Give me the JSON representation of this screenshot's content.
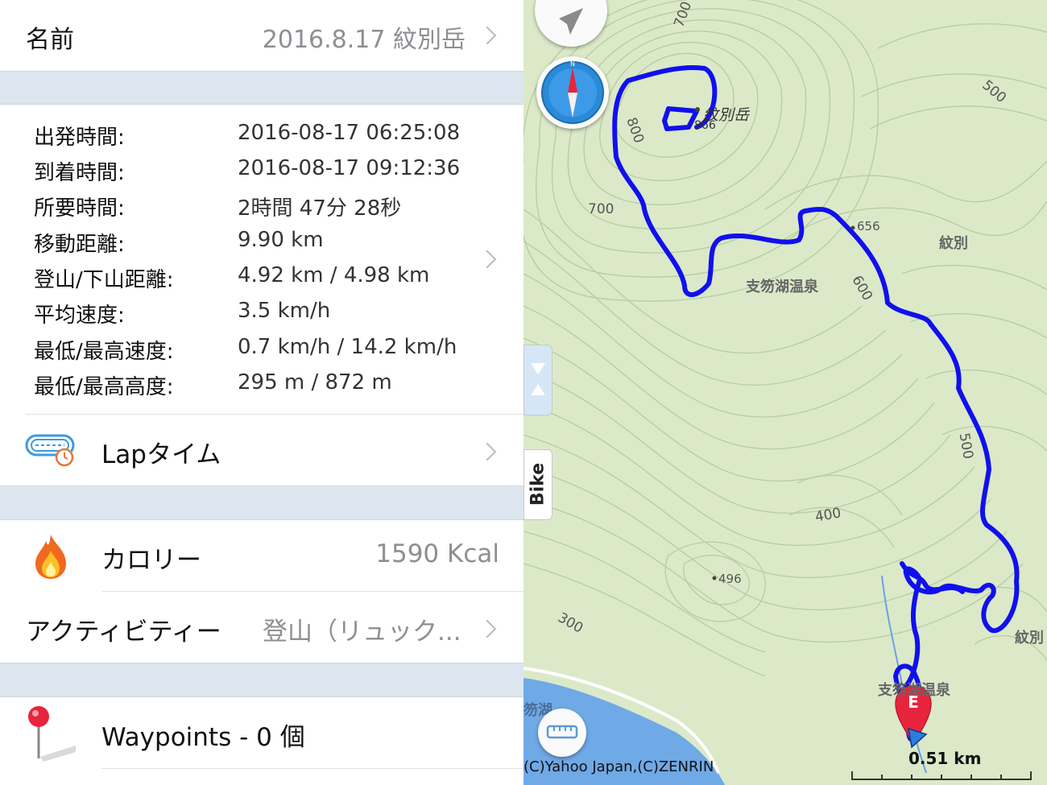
{
  "record": {
    "name_label": "名前",
    "name_value": "2016.8.17 紋別岳"
  },
  "stats": [
    {
      "label": "出発時間:",
      "value": "2016-08-17 06:25:08"
    },
    {
      "label": "到着時間:",
      "value": "2016-08-17 09:12:36"
    },
    {
      "label": "所要時間:",
      "value": "2時間 47分 28秒"
    },
    {
      "label": "移動距離:",
      "value": "9.90 km"
    },
    {
      "label": "登山/下山距離:",
      "value": "4.92 km / 4.98 km"
    },
    {
      "label": "平均速度:",
      "value": "3.5 km/h"
    },
    {
      "label": "最低/最高速度:",
      "value": "0.7 km/h / 14.2 km/h"
    },
    {
      "label": "最低/最高高度:",
      "value": "295 m / 872 m"
    }
  ],
  "lap": {
    "label": "Lapタイム"
  },
  "calories": {
    "label": "カロリー",
    "value": "1590 Kcal"
  },
  "activity": {
    "label": "アクティビティー",
    "value": "登山（リュック..."
  },
  "waypoints": {
    "label": "Waypoints - 0 個"
  },
  "map": {
    "mode_tab": "Bike",
    "credit": "(C)Yahoo Japan,(C)ZENRIN",
    "scale": "0.51 km",
    "labels": {
      "peak": "紋別岳",
      "peak_elev": "866",
      "onsen1": "支笏湖温泉",
      "onsen2": "支笏湖温泉",
      "monbetsu1": "紋別",
      "monbetsu2": "紋別",
      "lake": "笏湖",
      "pt656": "656",
      "pt496": "496",
      "c700a": "700",
      "c700b": "700",
      "c800": "800",
      "c500a": "500",
      "c500b": "500",
      "c600": "600",
      "c400": "400",
      "c300": "300"
    },
    "track_color": "#1010ee",
    "marker_letter": "E"
  },
  "colors": {
    "separator": "#dde6ef",
    "secondary_text": "#8e8e93",
    "pin_red": "#e8243c"
  }
}
